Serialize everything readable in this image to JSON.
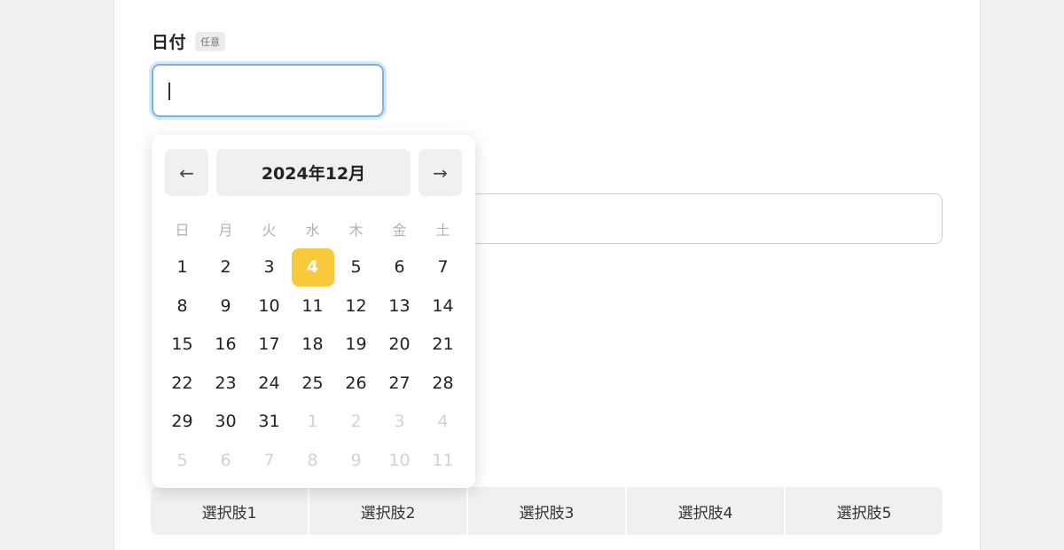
{
  "form": {
    "date_label": "日付",
    "optional_badge": "任意",
    "date_value": ""
  },
  "calendar": {
    "prev_icon": "←",
    "next_icon": "→",
    "month_label": "2024年12月",
    "weekdays": [
      "日",
      "月",
      "火",
      "水",
      "木",
      "金",
      "土"
    ],
    "weeks": [
      [
        "1",
        "2",
        "3",
        "4",
        "5",
        "6",
        "7"
      ],
      [
        "8",
        "9",
        "10",
        "11",
        "12",
        "13",
        "14"
      ],
      [
        "15",
        "16",
        "17",
        "18",
        "19",
        "20",
        "21"
      ],
      [
        "22",
        "23",
        "24",
        "25",
        "26",
        "27",
        "28"
      ],
      [
        "29",
        "30",
        "31",
        "1",
        "2",
        "3",
        "4"
      ],
      [
        "5",
        "6",
        "7",
        "8",
        "9",
        "10",
        "11"
      ]
    ],
    "outside_month": [
      [
        false,
        false,
        false,
        false,
        false,
        false,
        false
      ],
      [
        false,
        false,
        false,
        false,
        false,
        false,
        false
      ],
      [
        false,
        false,
        false,
        false,
        false,
        false,
        false
      ],
      [
        false,
        false,
        false,
        false,
        false,
        false,
        false
      ],
      [
        false,
        false,
        false,
        true,
        true,
        true,
        true
      ],
      [
        true,
        true,
        true,
        true,
        true,
        true,
        true
      ]
    ],
    "selected_day": "4",
    "accent_color": "#f8c93a"
  },
  "segmented": {
    "options": [
      "選択肢1",
      "選択肢2",
      "選択肢3",
      "選択肢4",
      "選択肢5"
    ]
  }
}
